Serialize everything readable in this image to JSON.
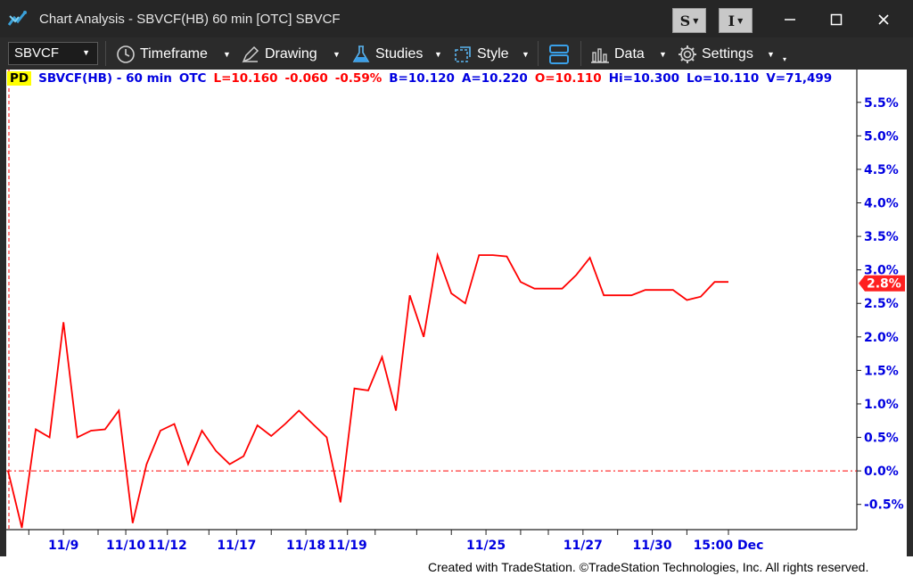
{
  "window": {
    "title": "Chart Analysis - SBVCF(HB) 60 min [OTC] SBVCF",
    "s_button_label": "S",
    "i_button_label": "I"
  },
  "toolbar": {
    "symbol_value": "SBVCF",
    "timeframe_label": "Timeframe",
    "drawing_label": "Drawing",
    "studies_label": "Studies",
    "style_label": "Style",
    "data_label": "Data",
    "settings_label": "Settings"
  },
  "status": {
    "badge": "PD",
    "symbol_interval": "SBVCF(HB) - 60 min",
    "exchange": "OTC",
    "last": "L=10.160",
    "change": "-0.060",
    "change_pct": "-0.59%",
    "bid": "B=10.120",
    "ask": "A=10.220",
    "open": "O=10.110",
    "high": "Hi=10.300",
    "low": "Lo=10.110",
    "volume": "V=71,499"
  },
  "colors": {
    "price_line": "#ff0000",
    "axis_text": "#0000e0",
    "status_red": "#ff0000",
    "status_blue": "#0000e0",
    "window_bg": "#2b2b2b",
    "last_value_box": "#ff2020"
  },
  "chart_data": {
    "type": "line",
    "y_unit": "%",
    "ylim": [
      -0.85,
      5.75
    ],
    "y_ticks": [
      -0.5,
      0.0,
      0.5,
      1.0,
      1.5,
      2.0,
      2.5,
      3.0,
      3.5,
      4.0,
      4.5,
      5.0,
      5.5
    ],
    "y_tick_labels": [
      "-0.5%",
      "0.0%",
      "0.5%",
      "1.0%",
      "1.5%",
      "2.0%",
      "2.5%",
      "3.0%",
      "3.5%",
      "4.0%",
      "4.5%",
      "5.0%",
      "5.5%"
    ],
    "x_tick_labels": [
      {
        "label": "11/9",
        "bar": 4
      },
      {
        "label": "11/10",
        "bar": 8.5
      },
      {
        "label": "11/12",
        "bar": 11.5
      },
      {
        "label": "11/17",
        "bar": 16.5
      },
      {
        "label": "11/18",
        "bar": 21.5
      },
      {
        "label": "11/19",
        "bar": 24.5
      },
      {
        "label": "11/25",
        "bar": 34.5
      },
      {
        "label": "11/27",
        "bar": 41.5
      },
      {
        "label": "11/30",
        "bar": 46.5
      },
      {
        "label": "15:00 Dec",
        "bar": 52
      }
    ],
    "x_minor_ticks": [
      1.5,
      6.5,
      14.5,
      19,
      26.5,
      29.5,
      32,
      37,
      39,
      44,
      49
    ],
    "reference_line": 0.0,
    "last_value_label": "2.8%",
    "last_value": 2.8,
    "series": [
      {
        "values": [
          0.0,
          -0.85,
          0.62,
          0.5,
          2.22,
          0.5,
          0.6,
          0.62,
          0.9,
          -0.78,
          0.1,
          0.6,
          0.7,
          0.1,
          0.6,
          0.3,
          0.1,
          0.22,
          0.68,
          0.52,
          0.7,
          0.9,
          0.7,
          0.5,
          -0.47,
          1.23,
          1.2,
          1.7,
          0.9,
          2.62,
          2.0,
          3.22,
          2.65,
          2.5,
          3.22,
          3.22,
          3.2,
          2.82,
          2.72,
          2.72,
          2.72,
          2.92,
          3.18,
          2.62,
          2.62,
          2.62,
          2.7,
          2.7,
          2.7,
          2.55,
          2.6,
          2.82,
          2.82
        ]
      }
    ]
  },
  "footer": {
    "copyright": "Created with TradeStation. ©TradeStation Technologies, Inc. All rights reserved."
  }
}
